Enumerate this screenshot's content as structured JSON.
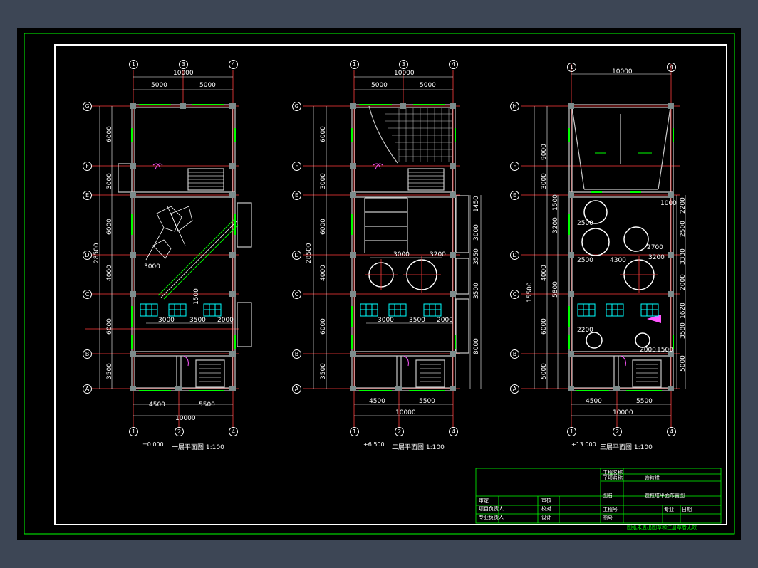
{
  "colors": {
    "background": "#000000",
    "frame": "#00ff00",
    "sheet_border": "#ffffff",
    "grid_line": "#ff3b3b",
    "axis_bubble": "#ffffff",
    "wall": "#c9c9c9",
    "column": "#7d8c8c",
    "window": "#00ff00",
    "door": "#ff55ff",
    "equipment": "#00ffff",
    "dimension": "#ffffff",
    "label": "#00ff00",
    "title_block_text": "#ffffff"
  },
  "plans": [
    {
      "id": "plan-1",
      "title": "一层平面图 1:100",
      "elevation": "±0.000",
      "top_axes": [
        "1",
        "3",
        "4"
      ],
      "bottom_axes": [
        "1",
        "2",
        "4"
      ],
      "row_axes": [
        "G",
        "F",
        "E",
        "D",
        "C",
        "B",
        "A"
      ],
      "top_dims": [
        "10000",
        "5000",
        "5000"
      ],
      "bottom_dims": [
        "4500",
        "5500",
        "10000"
      ],
      "left_dims": [
        "6000",
        "3000",
        "6000",
        "4000",
        "6000",
        "3500"
      ],
      "overall_left": "28500",
      "inner_dims": [
        "3000",
        "3500",
        "2000"
      ],
      "notes": [
        "1500",
        "3000"
      ]
    },
    {
      "id": "plan-2",
      "title": "二层平面图 1:100",
      "elevation": "+6.500",
      "top_axes": [
        "1",
        "3",
        "4"
      ],
      "bottom_axes": [
        "1",
        "2",
        "4"
      ],
      "row_axes": [
        "G",
        "F",
        "E",
        "D",
        "C",
        "B",
        "A"
      ],
      "top_dims": [
        "10000",
        "5000",
        "5000"
      ],
      "bottom_dims": [
        "4500",
        "5500",
        "10000"
      ],
      "left_dims": [
        "6000",
        "3000",
        "6000",
        "4000",
        "6000",
        "3500"
      ],
      "overall_left": "28500",
      "right_dims": [
        "1450",
        "3000",
        "3550",
        "3500",
        "8000"
      ],
      "inner_dims": [
        "3000",
        "3500",
        "2000"
      ],
      "tank_dims": [
        "3000",
        "3200"
      ]
    },
    {
      "id": "plan-3",
      "title": "三层平面图 1:100",
      "elevation": "+13.000",
      "top_axes": [
        "1",
        "4"
      ],
      "bottom_axes": [
        "1",
        "2",
        "4"
      ],
      "row_axes": [
        "H",
        "F",
        "E",
        "D",
        "C",
        "B",
        "A"
      ],
      "top_dims": [
        "10000"
      ],
      "bottom_dims": [
        "4500",
        "5500",
        "10000"
      ],
      "left_dims": [
        "9000",
        "3000",
        "3200",
        "4000",
        "6000",
        "5000"
      ],
      "overall_left": "15500",
      "left_small": [
        "1500",
        "5800"
      ],
      "right_dims": [
        "2200",
        "2500",
        "3330",
        "2000",
        "1620",
        "3580",
        "5000"
      ],
      "inner_dims": [
        "2500",
        "2500",
        "4300",
        "3200",
        "2200",
        "2000",
        "1500"
      ],
      "small_dims": [
        "1000",
        "2700"
      ]
    }
  ],
  "title_block": {
    "project_name_label": "工程名称",
    "sub_item_label": "子项名称",
    "sub_item_value": "造粒塔",
    "drawing_name_label": "图名",
    "drawing_name_value": "造粒塔平面布置图",
    "left_rows": [
      "审定",
      "项目负责人",
      "专业负责人"
    ],
    "mid_rows": [
      "审核",
      "校对",
      "设计"
    ],
    "right_labels": [
      "工程号",
      "图号",
      "专业",
      "日期"
    ],
    "footer": "图纸未盖出图章和注册章者无效"
  }
}
